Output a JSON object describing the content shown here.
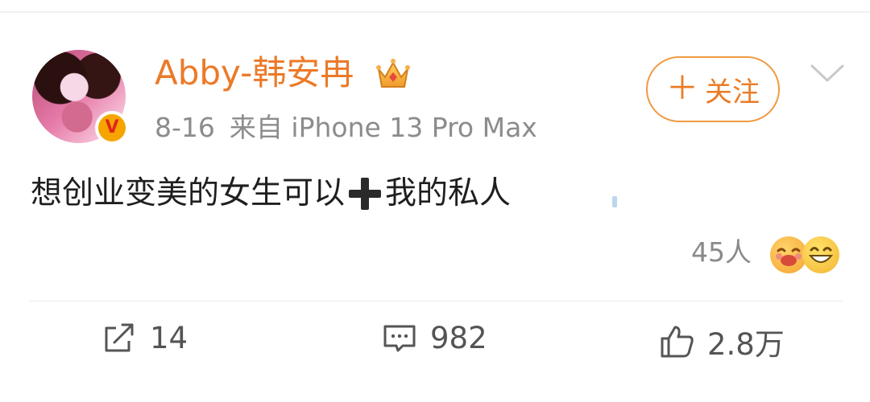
{
  "post": {
    "username": "Abby-韩安冉",
    "date": "8-16",
    "source": "来自 iPhone 13 Pro Max",
    "follow_label": "关注",
    "text_before": "想创业变美的女生可以",
    "text_after": "我的私人",
    "reaction_count": "45人"
  },
  "actions": {
    "repost_count": "14",
    "comment_count": "982",
    "like_count": "2.8万"
  },
  "icons": {
    "crown": "crown-icon",
    "verified": "verified-badge-icon",
    "chevron": "chevron-down-icon",
    "plus": "plus-icon",
    "repost": "repost-icon",
    "comment": "comment-icon",
    "like": "thumbs-up-icon"
  },
  "colors": {
    "accent": "#ec7a28",
    "meta": "#8c8c8c",
    "text": "#1f1f1f"
  }
}
